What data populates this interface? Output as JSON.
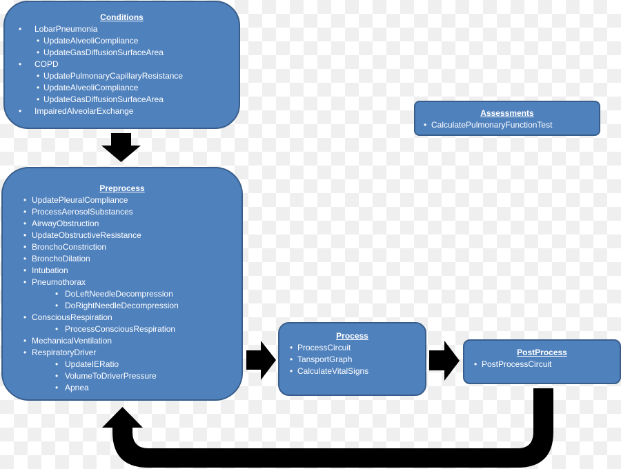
{
  "diagram": {
    "conditions": {
      "title": "Conditions",
      "items": [
        {
          "text": "LobarPneumonia",
          "level": 1
        },
        {
          "text": "UpdateAlveoliCompliance",
          "level": 2
        },
        {
          "text": "UpdateGasDiffusionSurfaceArea",
          "level": 2
        },
        {
          "text": "COPD",
          "level": 1
        },
        {
          "text": "UpdatePulmonaryCapillaryResistance",
          "level": 2
        },
        {
          "text": "UpdateAlveoliCompliance",
          "level": 2
        },
        {
          "text": "UpdateGasDiffusionSurfaceArea",
          "level": 2
        },
        {
          "text": "ImpairedAlveolarExchange",
          "level": 1
        }
      ]
    },
    "assessments": {
      "title": "Assessments",
      "items": [
        {
          "text": "CalculatePulmonaryFunctionTest",
          "level": 1
        }
      ]
    },
    "preprocess": {
      "title": "Preprocess",
      "items": [
        {
          "text": "UpdatePleuralCompliance",
          "level": 1
        },
        {
          "text": "ProcessAerosolSubstances",
          "level": 1
        },
        {
          "text": "AirwayObstruction",
          "level": 1
        },
        {
          "text": "UpdateObstructiveResistance",
          "level": 1
        },
        {
          "text": "BronchoConstriction",
          "level": 1
        },
        {
          "text": "BronchoDilation",
          "level": 1
        },
        {
          "text": "Intubation",
          "level": 1
        },
        {
          "text": "Pneumothorax",
          "level": 1
        },
        {
          "text": "DoLeftNeedleDecompression",
          "level": 2
        },
        {
          "text": "DoRightNeedleDecompression",
          "level": 2
        },
        {
          "text": "ConsciousRespiration",
          "level": 1
        },
        {
          "text": "ProcessConsciousRespiration",
          "level": 2
        },
        {
          "text": "MechanicalVentilation",
          "level": 1
        },
        {
          "text": "RespiratoryDriver",
          "level": 1
        },
        {
          "text": "UpdateIERatio",
          "level": 2
        },
        {
          "text": "VolumeToDriverPressure",
          "level": 2
        },
        {
          "text": "Apnea",
          "level": 2
        }
      ]
    },
    "process": {
      "title": "Process",
      "items": [
        {
          "text": "ProcessCircuit",
          "level": 1
        },
        {
          "text": "TansportGraph",
          "level": 1
        },
        {
          "text": "CalculateVitalSigns",
          "level": 1
        }
      ]
    },
    "postprocess": {
      "title": "PostProcess",
      "items": [
        {
          "text": "PostProcessCircuit",
          "level": 1
        }
      ]
    },
    "colors": {
      "box_fill": "#4f81bd",
      "box_border": "#385d8a",
      "arrow": "#000000",
      "text": "#ffffff"
    }
  }
}
